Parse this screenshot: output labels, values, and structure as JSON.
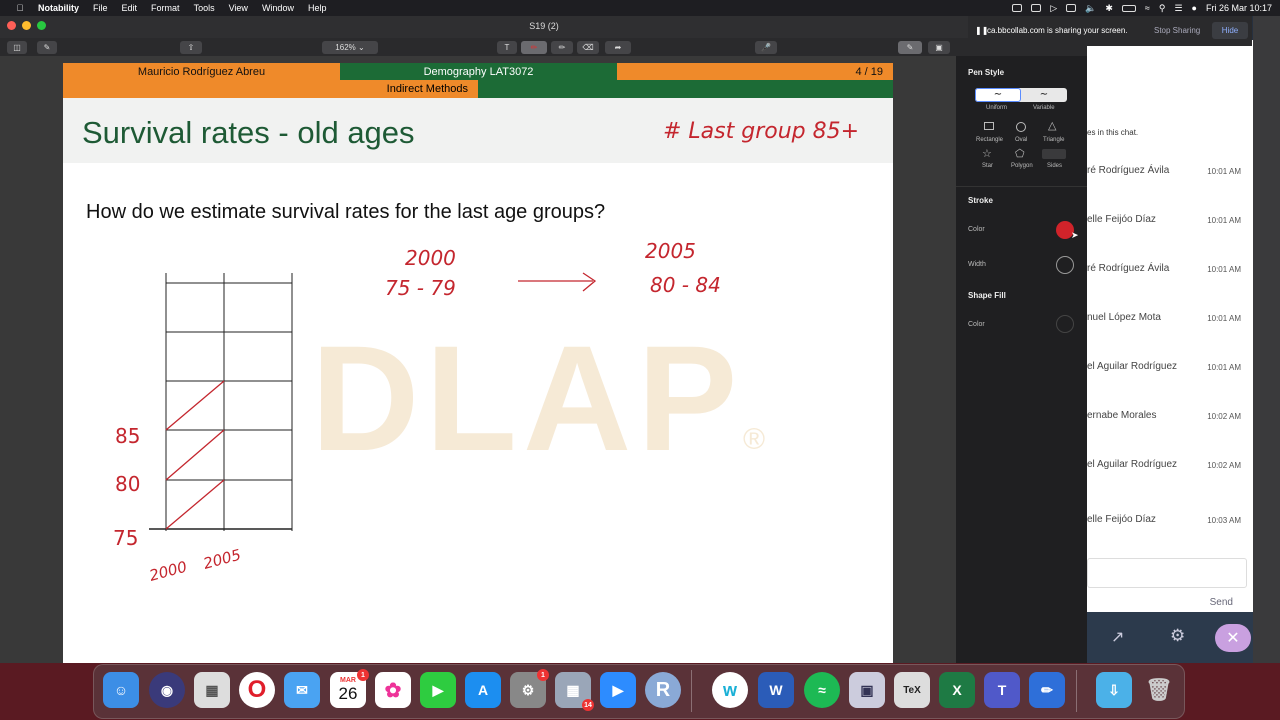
{
  "menubar": {
    "app": "Notability",
    "menus": [
      "File",
      "Edit",
      "Format",
      "Tools",
      "View",
      "Window",
      "Help"
    ],
    "clock": "Fri 26 Mar  10:17"
  },
  "window": {
    "title": "S19 (2)",
    "zoom": "162%"
  },
  "slide": {
    "author": "Mauricio Rodríguez Abreu",
    "course": "Demography LAT3072",
    "page": "4 / 19",
    "section": "Indirect Methods",
    "title": "Survival rates - old ages",
    "question": "How do we estimate survival rates for the last age groups?",
    "watermark": "DLAP",
    "watermark_mark": "®",
    "colors": {
      "orange": "#ef8a2a",
      "green": "#1c6b36",
      "title": "#1e5a35",
      "ink": "#c4262e"
    }
  },
  "handwriting": {
    "note": "# Last group 85+",
    "year_from": "2000",
    "age_from": "75 - 79",
    "arrow": "→",
    "year_to": "2005",
    "age_to": "80 - 84",
    "y_labels": [
      "85",
      "80",
      "75"
    ],
    "x_labels": [
      "2000",
      "2005"
    ]
  },
  "pen_panel": {
    "pen_style": "Pen Style",
    "styles": [
      "Uniform",
      "Variable"
    ],
    "shapes": [
      "Rectangle",
      "Oval",
      "Triangle",
      "Star",
      "Polygon",
      "Sides"
    ],
    "stroke": "Stroke",
    "color_label": "Color",
    "width_label": "Width",
    "shape_fill": "Shape Fill",
    "fill_color_label": "Color",
    "stroke_color": "#d0232a"
  },
  "share_bar": {
    "message": "ca.bbcollab.com is sharing your screen.",
    "stop": "Stop Sharing",
    "hide": "Hide"
  },
  "chat": {
    "intro": "es in this chat.",
    "messages": [
      {
        "name": "ré Rodríguez Ávila",
        "time": "10:01 AM"
      },
      {
        "name": "elle Feijóo Díaz",
        "time": "10:01 AM"
      },
      {
        "name": "ré Rodríguez Ávila",
        "time": "10:01 AM"
      },
      {
        "name": "nuel López Mota",
        "time": "10:01 AM"
      },
      {
        "name": "el Aguilar Rodríguez",
        "time": "10:01 AM"
      },
      {
        "name": "ernabe Morales",
        "time": "10:02 AM"
      },
      {
        "name": "el Aguilar Rodríguez",
        "time": "10:02 AM"
      },
      {
        "name": "elle Feijóo Díaz",
        "time": "10:03 AM"
      }
    ],
    "send": "Send"
  },
  "dock": {
    "calendar_month": "MAR",
    "calendar_day": "26",
    "badges": {
      "calendar": "1",
      "prefs": "1",
      "launch": "14"
    }
  }
}
